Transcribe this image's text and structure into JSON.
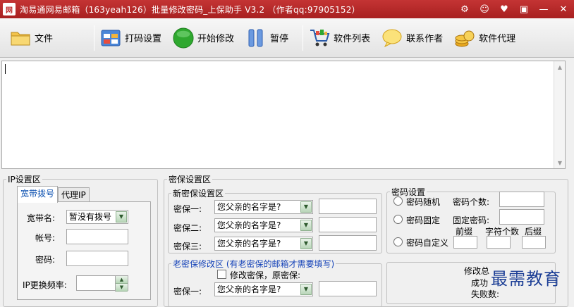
{
  "window": {
    "title": "淘易通网易邮箱（163yeah126）批量修改密码_上保助手 V3.2  （作者qq:97905152）",
    "app_icon_text": "网"
  },
  "toolbar": {
    "file": "文件",
    "captcha_settings": "打码设置",
    "start_modify": "开始修改",
    "pause": "暂停",
    "software_list": "软件列表",
    "contact_author": "联系作者",
    "software_agent": "软件代理"
  },
  "ip_section": {
    "title": "IP设置区",
    "tabs": [
      "宽带拨号",
      "代理IP"
    ],
    "broadband_name_label": "宽带名:",
    "broadband_name_value": "暂没有拨号",
    "account_label": "帐号:",
    "password_label": "密码:",
    "ip_change_label": "IP更换频率:"
  },
  "security_section": {
    "title": "密保设置区",
    "new_group_title": "新密保设置区",
    "q1_label": "密保一:",
    "q2_label": "密保二:",
    "q3_label": "密保三:",
    "question_value": "您父亲的名字是?",
    "old_group_title": "老密保修改区  (有老密保的邮箱才需要填写)",
    "old_check_label": "修改密保，原密保:",
    "old_q1_label": "密保一:"
  },
  "password_section": {
    "title": "密码设置",
    "random_label": "密码随机",
    "count_label": "密码个数:",
    "fixed_label": "密码固定",
    "fixed_pwd_label": "固定密码:",
    "prefix_label": "前缀",
    "char_count_label": "字符个数",
    "suffix_label": "后缀",
    "custom_label": "密码自定义"
  },
  "stats": {
    "total_label": "修改总",
    "success_label": "成功",
    "fail_label": "失败数:"
  },
  "watermark": "最需教育"
}
